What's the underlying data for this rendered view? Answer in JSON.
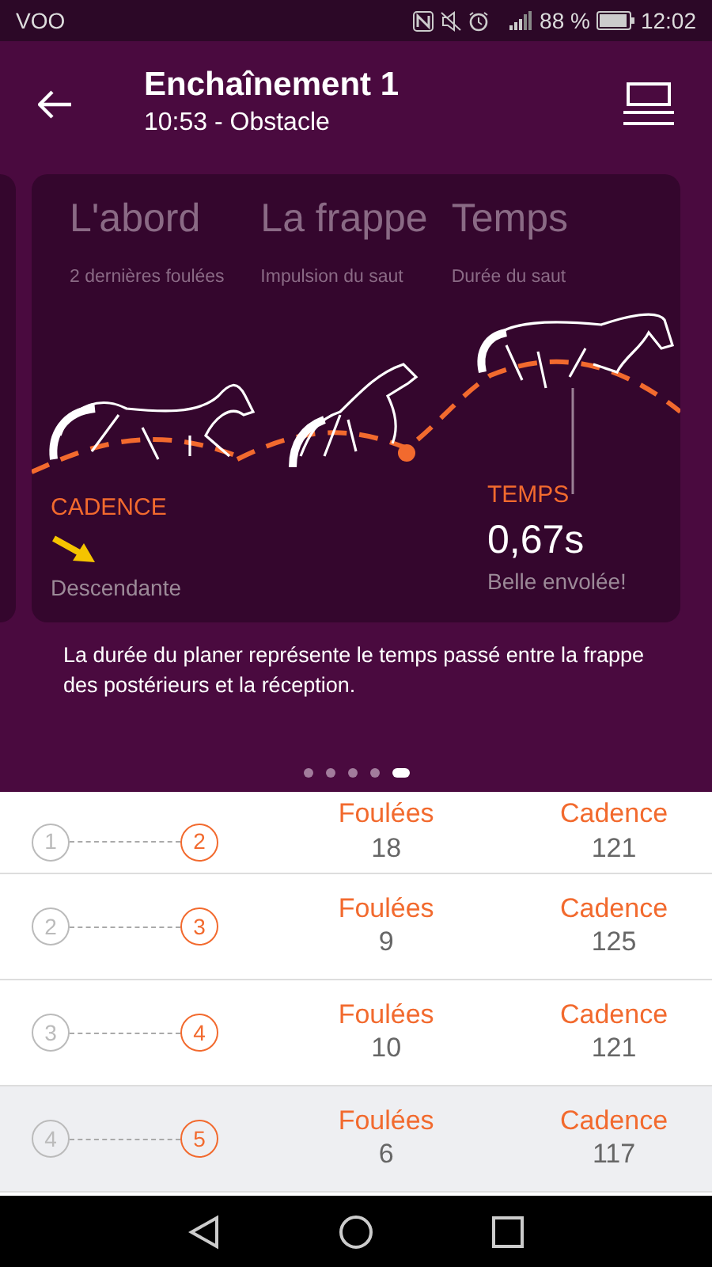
{
  "status_bar": {
    "carrier": "VOO",
    "battery": "88 %",
    "time": "12:02"
  },
  "header": {
    "title": "Enchaînement 1",
    "subtitle": "10:53 - Obstacle"
  },
  "card": {
    "phases": [
      {
        "title": "L'abord",
        "subtitle": "2 dernières foulées"
      },
      {
        "title": "La frappe",
        "subtitle": "Impulsion du saut"
      },
      {
        "title": "Temps",
        "subtitle": "Durée du saut"
      }
    ],
    "left_metric": {
      "label": "CADENCE",
      "caption": "Descendante"
    },
    "right_metric": {
      "label": "TEMPS",
      "value": "0,67s",
      "caption": "Belle envolée!"
    }
  },
  "description": "La durée du planer représente le temps passé entre la frappe des postérieurs et la réception.",
  "pager": [
    {
      "selected": false
    },
    {
      "selected": false
    },
    {
      "selected": false
    },
    {
      "selected": false
    },
    {
      "selected": true
    }
  ],
  "rows": [
    {
      "from": "1",
      "to": "2",
      "strides_label": "Foulées",
      "strides": "18",
      "cadence_label": "Cadence",
      "cadence": "121",
      "selected": false
    },
    {
      "from": "2",
      "to": "3",
      "strides_label": "Foulées",
      "strides": "9",
      "cadence_label": "Cadence",
      "cadence": "125",
      "selected": false
    },
    {
      "from": "3",
      "to": "4",
      "strides_label": "Foulées",
      "strides": "10",
      "cadence_label": "Cadence",
      "cadence": "121",
      "selected": false
    },
    {
      "from": "4",
      "to": "5",
      "strides_label": "Foulées",
      "strides": "6",
      "cadence_label": "Cadence",
      "cadence": "117",
      "selected": true
    }
  ]
}
